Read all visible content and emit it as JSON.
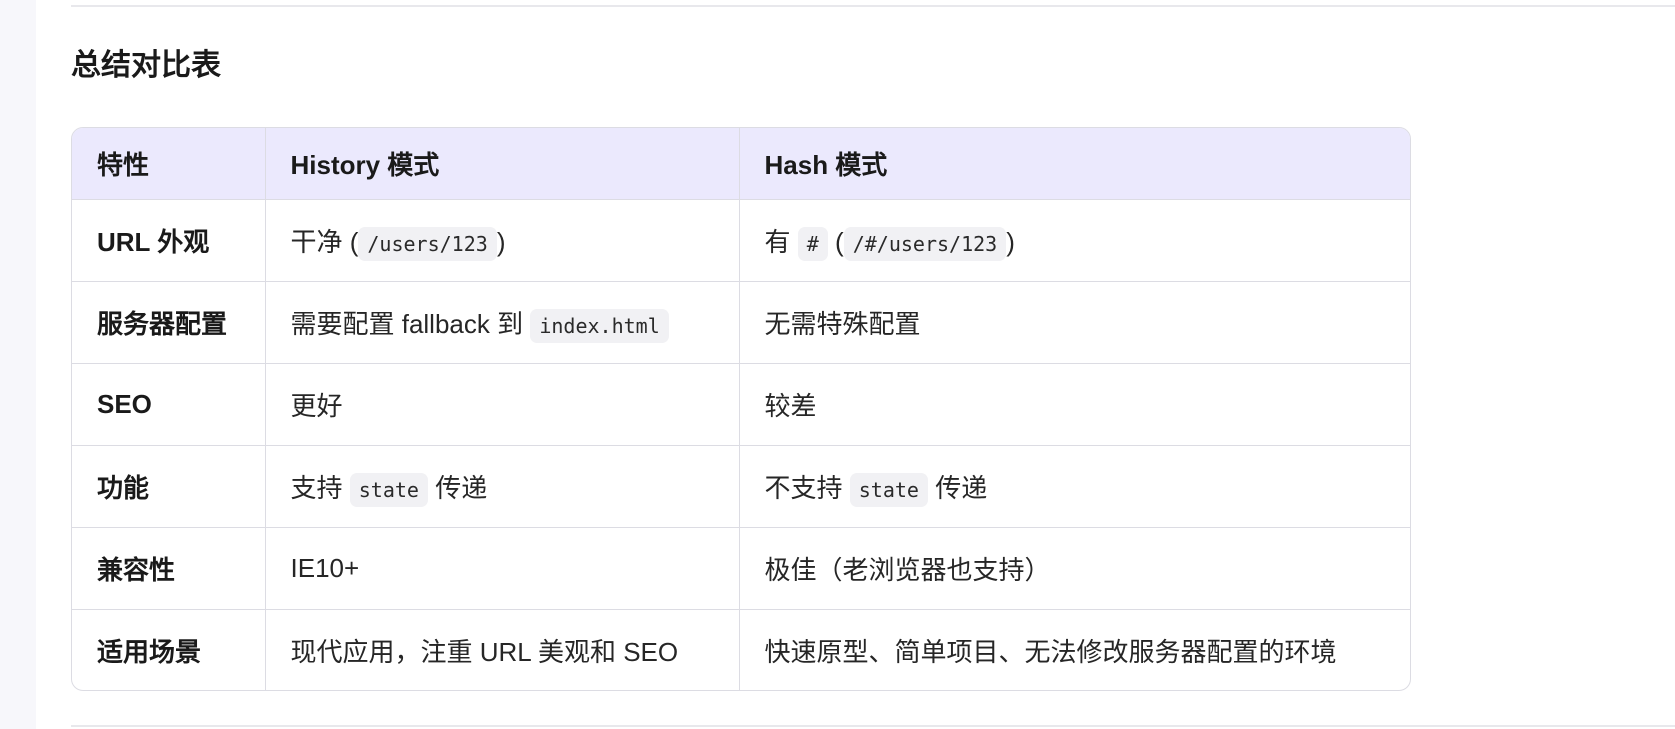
{
  "section": {
    "title": "总结对比表"
  },
  "table": {
    "headers": [
      "特性",
      "History 模式",
      "Hash 模式"
    ],
    "rows": [
      {
        "feature": "URL 外观",
        "history": {
          "pre": "干净 (",
          "code": "/users/123",
          "post": ")"
        },
        "hash": {
          "pre": "有",
          "code1": "#",
          "mid": "(",
          "code2": "/#/users/123",
          "post": ")"
        }
      },
      {
        "feature": "服务器配置",
        "history": {
          "pre": "需要配置 fallback 到",
          "code": "index.html"
        },
        "hash": "无需特殊配置"
      },
      {
        "feature": "SEO",
        "history": "更好",
        "hash": "较差"
      },
      {
        "feature": "功能",
        "history": {
          "pre": "支持",
          "code": "state",
          "post": "传递"
        },
        "hash": {
          "pre": "不支持",
          "code": "state",
          "post": "传递"
        }
      },
      {
        "feature": "兼容性",
        "history": "IE10+",
        "hash": "极佳（老浏览器也支持）"
      },
      {
        "feature": "适用场景",
        "history": "现代应用，注重 URL 美观和 SEO",
        "hash": "快速原型、简单项目、无法修改服务器配置的环境"
      }
    ]
  }
}
